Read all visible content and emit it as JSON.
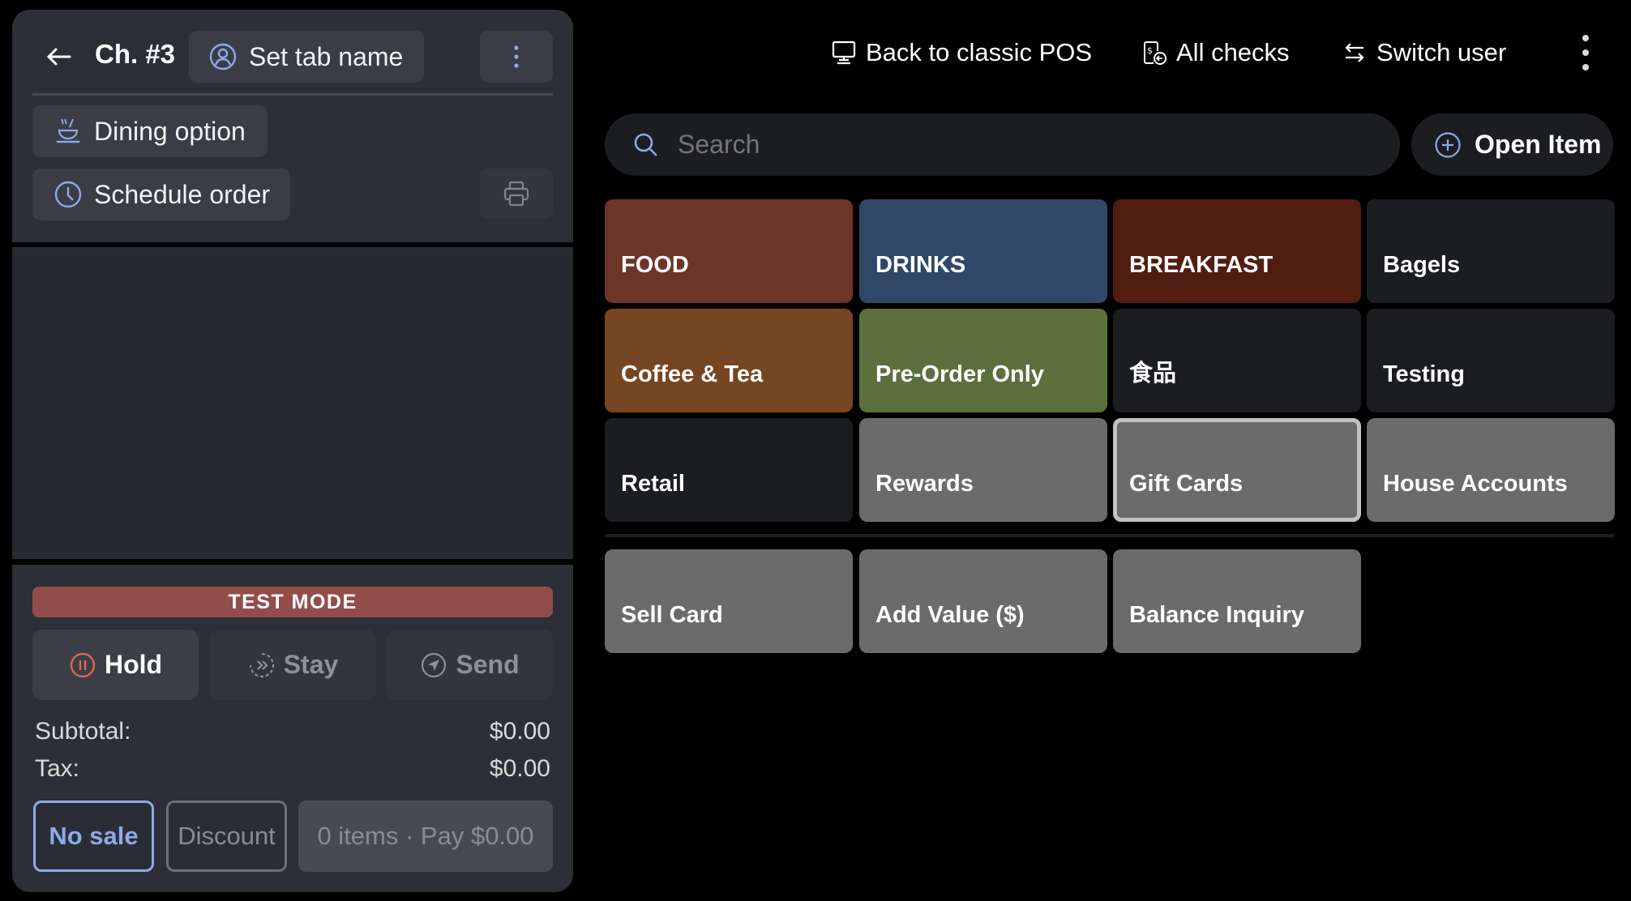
{
  "order": {
    "back_icon": "arrow-left-icon",
    "check_title": "Ch. #3",
    "set_tab_name": "Set tab name",
    "more_icon": "kebab-icon",
    "dining_option": "Dining option",
    "schedule_order": "Schedule order",
    "print_icon": "printer-icon",
    "test_mode": "TEST MODE",
    "actions": [
      {
        "label": "Hold",
        "icon": "pause-circle-icon",
        "enabled": true
      },
      {
        "label": "Stay",
        "icon": "fast-forward-circle-icon",
        "enabled": false
      },
      {
        "label": "Send",
        "icon": "send-circle-icon",
        "enabled": false
      }
    ],
    "subtotal_label": "Subtotal:",
    "subtotal_value": "$0.00",
    "tax_label": "Tax:",
    "tax_value": "$0.00",
    "no_sale": "No sale",
    "discount": "Discount",
    "pay": "0 items · Pay $0.00"
  },
  "header": {
    "back_to_classic": "Back to classic POS",
    "all_checks": "All checks",
    "switch_user": "Switch user"
  },
  "search": {
    "placeholder": "Search",
    "open_item": "Open Item"
  },
  "categories": [
    {
      "label": "FOOD",
      "color": "#6b3528"
    },
    {
      "label": "DRINKS",
      "color": "#314768"
    },
    {
      "label": "BREAKFAST",
      "color": "#521d11"
    },
    {
      "label": "Bagels",
      "color": "#1b1d21"
    },
    {
      "label": "Coffee & Tea",
      "color": "#764521"
    },
    {
      "label": "Pre-Order Only",
      "color": "#5c703d"
    },
    {
      "label": "食品",
      "color": "#1b1d21"
    },
    {
      "label": "Testing",
      "color": "#1b1d21"
    },
    {
      "label": "Retail",
      "color": "#1b1d21"
    },
    {
      "label": "Rewards",
      "color": "#6b6b6b"
    },
    {
      "label": "Gift Cards",
      "color": "#6b6b6b",
      "selected": true
    },
    {
      "label": "House Accounts",
      "color": "#6b6b6b"
    }
  ],
  "gift_card_actions": [
    {
      "label": "Sell Card",
      "color": "#6b6b6b"
    },
    {
      "label": "Add Value ($)",
      "color": "#6b6b6b"
    },
    {
      "label": "Balance Inquiry",
      "color": "#6b6b6b"
    }
  ],
  "colors": {
    "accent": "#8fa9e8",
    "hold": "#d9694f",
    "test_mode": "#924d4b"
  }
}
